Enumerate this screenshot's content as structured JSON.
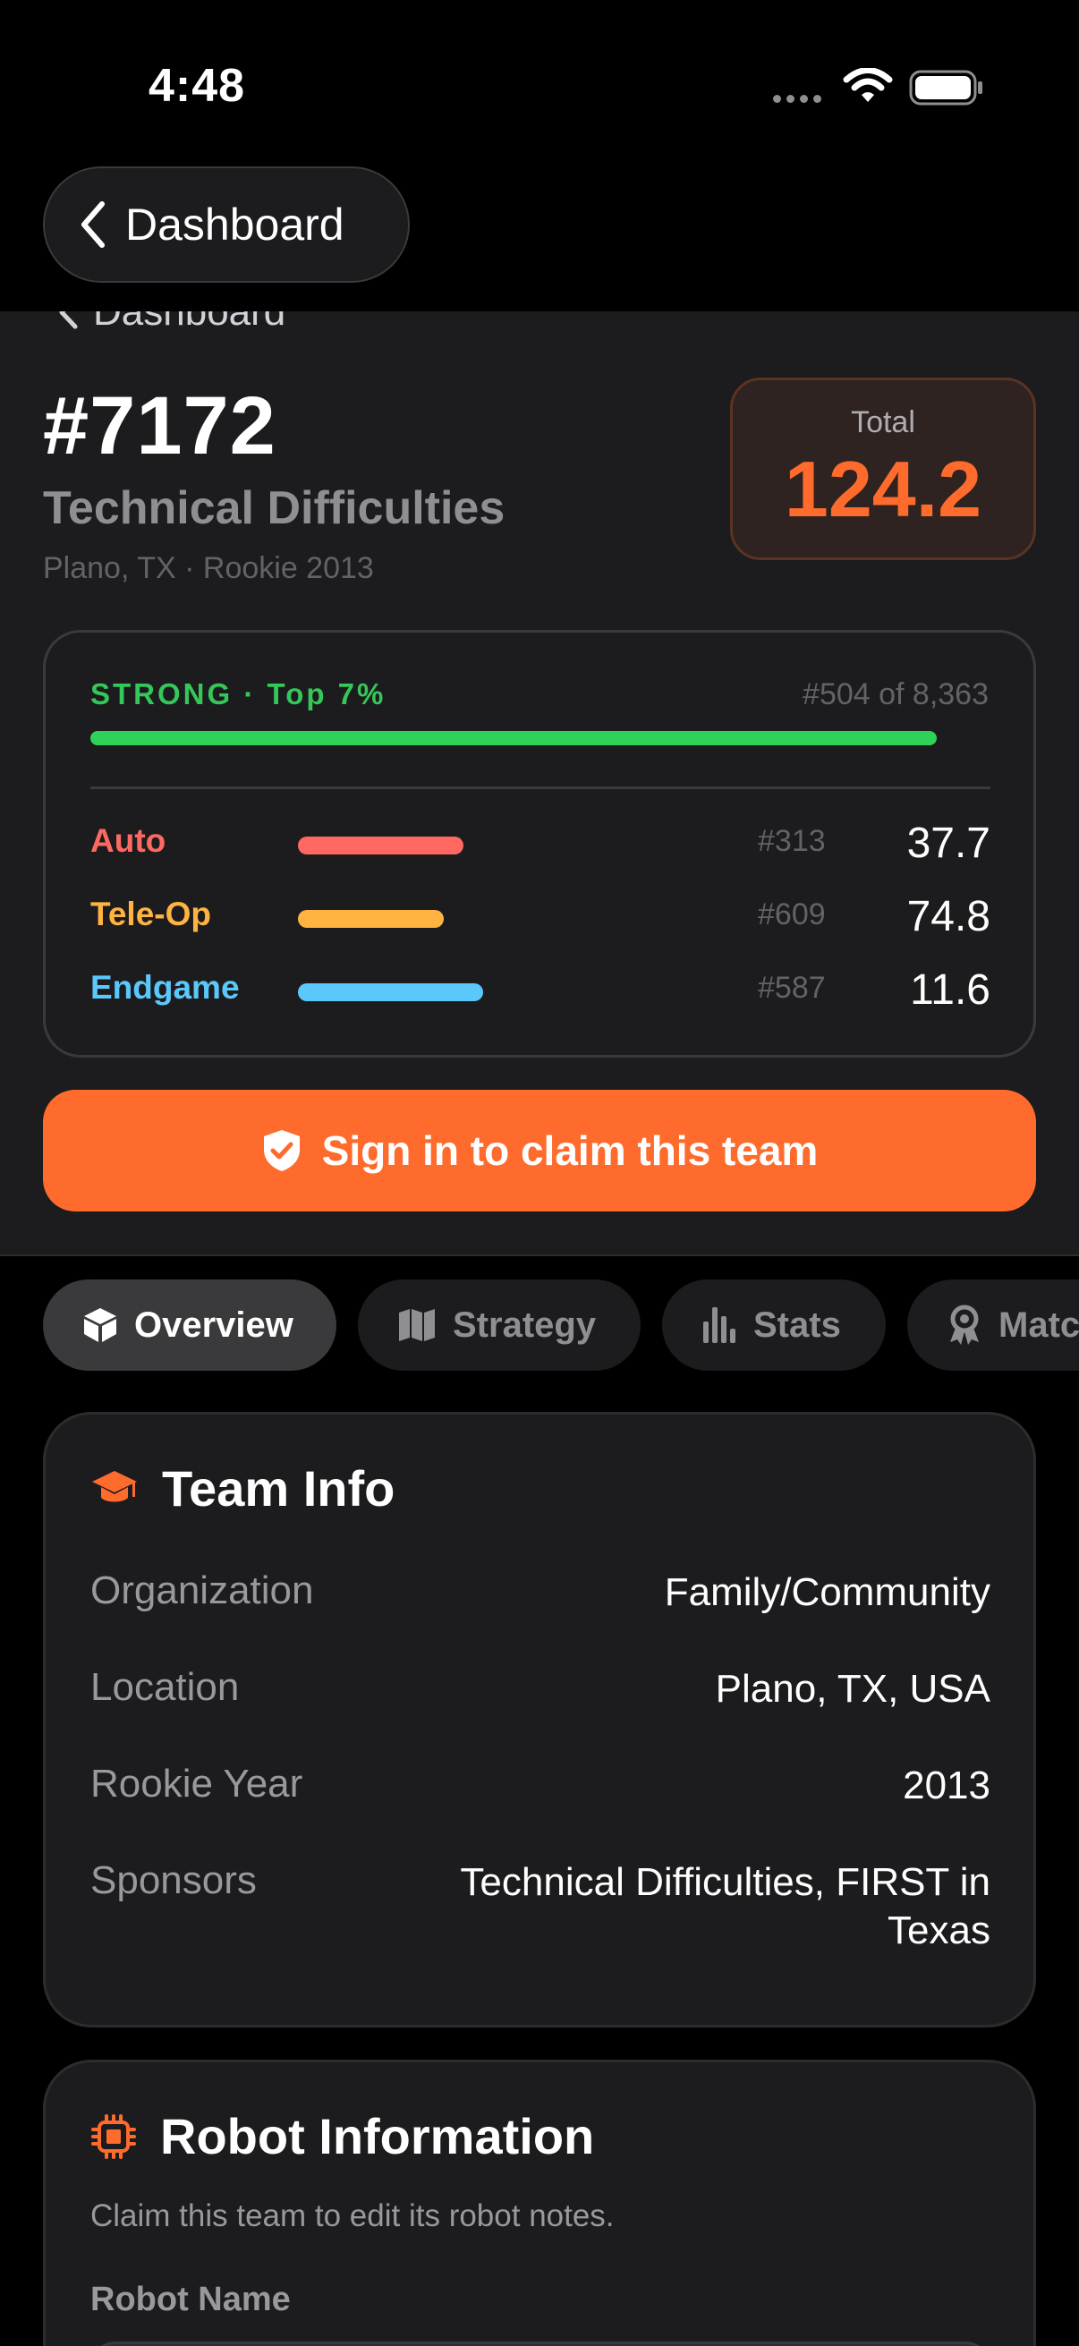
{
  "status_bar": {
    "time": "4:48",
    "icons": [
      "signal-dots-icon",
      "wifi-icon",
      "battery-icon"
    ]
  },
  "nav": {
    "back_label": "Dashboard",
    "ghost_back_label": "Dashboard"
  },
  "team": {
    "number": "#7172",
    "name": "Technical Difficulties",
    "meta": "Plano, TX · Rookie 2013",
    "total_label": "Total",
    "total_value": "124.2"
  },
  "ranking": {
    "tier": "STRONG · Top 7%",
    "overall_rank": "#504 of 8,363",
    "overall_fill": 0.94,
    "phases": [
      {
        "name": "Auto",
        "rank": "#313",
        "value": "37.7",
        "fill": 0.42,
        "color": "#ff6961"
      },
      {
        "name": "Tele-Op",
        "rank": "#609",
        "value": "74.8",
        "fill": 0.37,
        "color": "#ffb340"
      },
      {
        "name": "Endgame",
        "rank": "#587",
        "value": "11.6",
        "fill": 0.47,
        "color": "#5ac8fa"
      }
    ]
  },
  "claim_button": {
    "label": "Sign in to claim this team",
    "icon": "shield-check-icon"
  },
  "tabs": [
    {
      "label": "Overview",
      "icon": "cube-icon",
      "active": true
    },
    {
      "label": "Strategy",
      "icon": "map-icon",
      "active": false
    },
    {
      "label": "Stats",
      "icon": "bar-chart-icon",
      "active": false
    },
    {
      "label": "Matc",
      "icon": "award-icon",
      "active": false
    }
  ],
  "team_info": {
    "title": "Team Info",
    "icon": "graduation-cap-icon",
    "rows": [
      {
        "label": "Organization",
        "value": "Family/Community"
      },
      {
        "label": "Location",
        "value": "Plano, TX, USA"
      },
      {
        "label": "Rookie Year",
        "value": "2013"
      },
      {
        "label": "Sponsors",
        "value": "Technical Difficulties, FIRST in Texas"
      }
    ]
  },
  "robot_info": {
    "title": "Robot Information",
    "icon": "chip-icon",
    "subtitle": "Claim this team to edit its robot notes.",
    "field_label": "Robot Name"
  },
  "colors": {
    "accent": "#ff6b2c",
    "strong": "#34c759",
    "background": "#000000",
    "card": "#1c1c1e"
  }
}
